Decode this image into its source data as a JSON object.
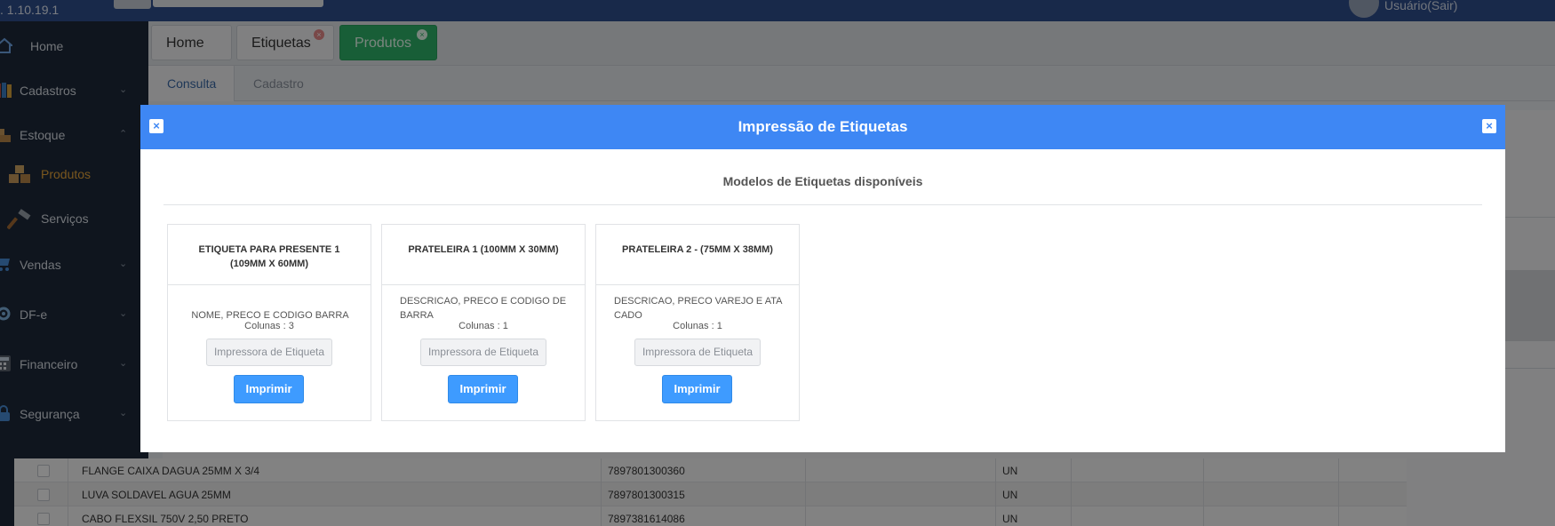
{
  "topbar": {
    "version": ". 1.10.19.1",
    "user_label": "Usuário(Sair)"
  },
  "sidebar": {
    "items": [
      {
        "label": "Home",
        "icon": "home-icon"
      },
      {
        "label": "Cadastros",
        "icon": "books-icon"
      },
      {
        "label": "Estoque",
        "icon": "boxes-icon"
      },
      {
        "label": "Produtos",
        "icon": "boxes-icon"
      },
      {
        "label": "Serviços",
        "icon": "hammer-icon"
      },
      {
        "label": "Vendas",
        "icon": "cart-icon"
      },
      {
        "label": "DF-e",
        "icon": "gear-icon"
      },
      {
        "label": "Financeiro",
        "icon": "calculator-icon"
      },
      {
        "label": "Segurança",
        "icon": "lock-icon"
      }
    ]
  },
  "tabs": {
    "home": "Home",
    "etiquetas": "Etiquetas",
    "produtos": "Produtos"
  },
  "subtabs": {
    "consulta": "Consulta",
    "cadastro": "Cadastro"
  },
  "table": {
    "rows": [
      {
        "descricao": "FLANGE CAIXA DAGUA 25MM X 3/4",
        "codigo": "7897801300360",
        "unidade": "UN"
      },
      {
        "descricao": "LUVA SOLDAVEL AGUA 25MM",
        "codigo": "7897801300315",
        "unidade": "UN"
      },
      {
        "descricao": "CABO FLEXSIL 750V 2,50 PRETO",
        "codigo": "7897381614086",
        "unidade": "UN"
      }
    ]
  },
  "modal": {
    "title": "Impressão de Etiquetas",
    "subtitle": "Modelos de Etiquetas disponíveis",
    "cards": [
      {
        "title": "ETIQUETA PARA PRESENTE 1 (109MM X 60MM)",
        "description": "NOME, PRECO E CODIGO BARRA",
        "columns": "Colunas : 3",
        "printer_placeholder": "Impressora de Etiqueta",
        "print_label": "Imprimir"
      },
      {
        "title": "PRATELEIRA 1 (100MM X 30MM)",
        "description": "DESCRICAO, PRECO E CODIGO DE BARRA",
        "columns": "Colunas : 1",
        "printer_placeholder": "Impressora de Etiqueta",
        "print_label": "Imprimir"
      },
      {
        "title": "PRATELEIRA 2 - (75MM X 38MM)",
        "description": "DESCRICAO, PRECO VAREJO E ATACADO",
        "columns": "Colunas : 1",
        "printer_placeholder": "Impressora de Etiqueta",
        "print_label": "Imprimir"
      }
    ]
  },
  "colors": {
    "modal_header": "#3e87f4",
    "print_button": "#3e9bff",
    "tab_active_green": "#2fb46a",
    "sidebar_bg": "#1e2a3a",
    "submenu_active": "#e9a63b"
  }
}
